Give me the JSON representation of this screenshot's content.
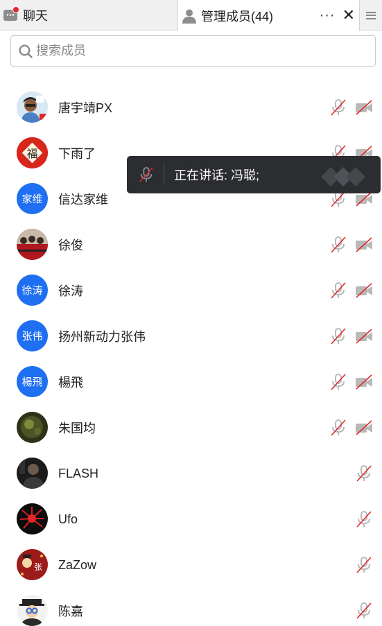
{
  "tabs": {
    "chat_label": "聊天",
    "members_label": "管理成员(44)",
    "more_label": "···",
    "close_label": "✕"
  },
  "search": {
    "placeholder": "搜索成员",
    "value": ""
  },
  "tooltip": {
    "text": "正在讲话: 冯聪;"
  },
  "members": [
    {
      "name": "唐宇靖PX",
      "avatar": "photo",
      "mic_muted": true,
      "camera_off": true
    },
    {
      "name": "下雨了",
      "avatar": "photo",
      "avatar_text": "福",
      "mic_muted": true,
      "camera_off": true
    },
    {
      "name": "信达家维",
      "avatar": "text",
      "avatar_text": "家维",
      "mic_muted": true,
      "camera_off": true
    },
    {
      "name": "徐俊",
      "avatar": "photo",
      "mic_muted": true,
      "camera_off": true
    },
    {
      "name": "徐涛",
      "avatar": "text",
      "avatar_text": "徐涛",
      "mic_muted": true,
      "camera_off": true
    },
    {
      "name": "扬州新动力张伟",
      "avatar": "text",
      "avatar_text": "张伟",
      "mic_muted": true,
      "camera_off": true
    },
    {
      "name": "楊飛",
      "avatar": "text",
      "avatar_text": "楊飛",
      "mic_muted": true,
      "camera_off": true
    },
    {
      "name": "朱国均",
      "avatar": "photo",
      "mic_muted": true,
      "camera_off": true
    },
    {
      "name": "FLASH",
      "avatar": "photo",
      "mic_muted": true,
      "camera_off": null
    },
    {
      "name": "Ufo",
      "avatar": "photo",
      "mic_muted": true,
      "camera_off": null
    },
    {
      "name": "ZaZow",
      "avatar": "photo",
      "avatar_text": "张",
      "mic_muted": true,
      "camera_off": null
    },
    {
      "name": "陈嘉",
      "avatar": "photo",
      "mic_muted": true,
      "camera_off": null
    }
  ],
  "colors": {
    "accent_blue": "#1f6ff2",
    "muted_red": "#e0282a",
    "tooltip_bg": "#2b2d31",
    "icon_gray": "#b9b9b9"
  }
}
